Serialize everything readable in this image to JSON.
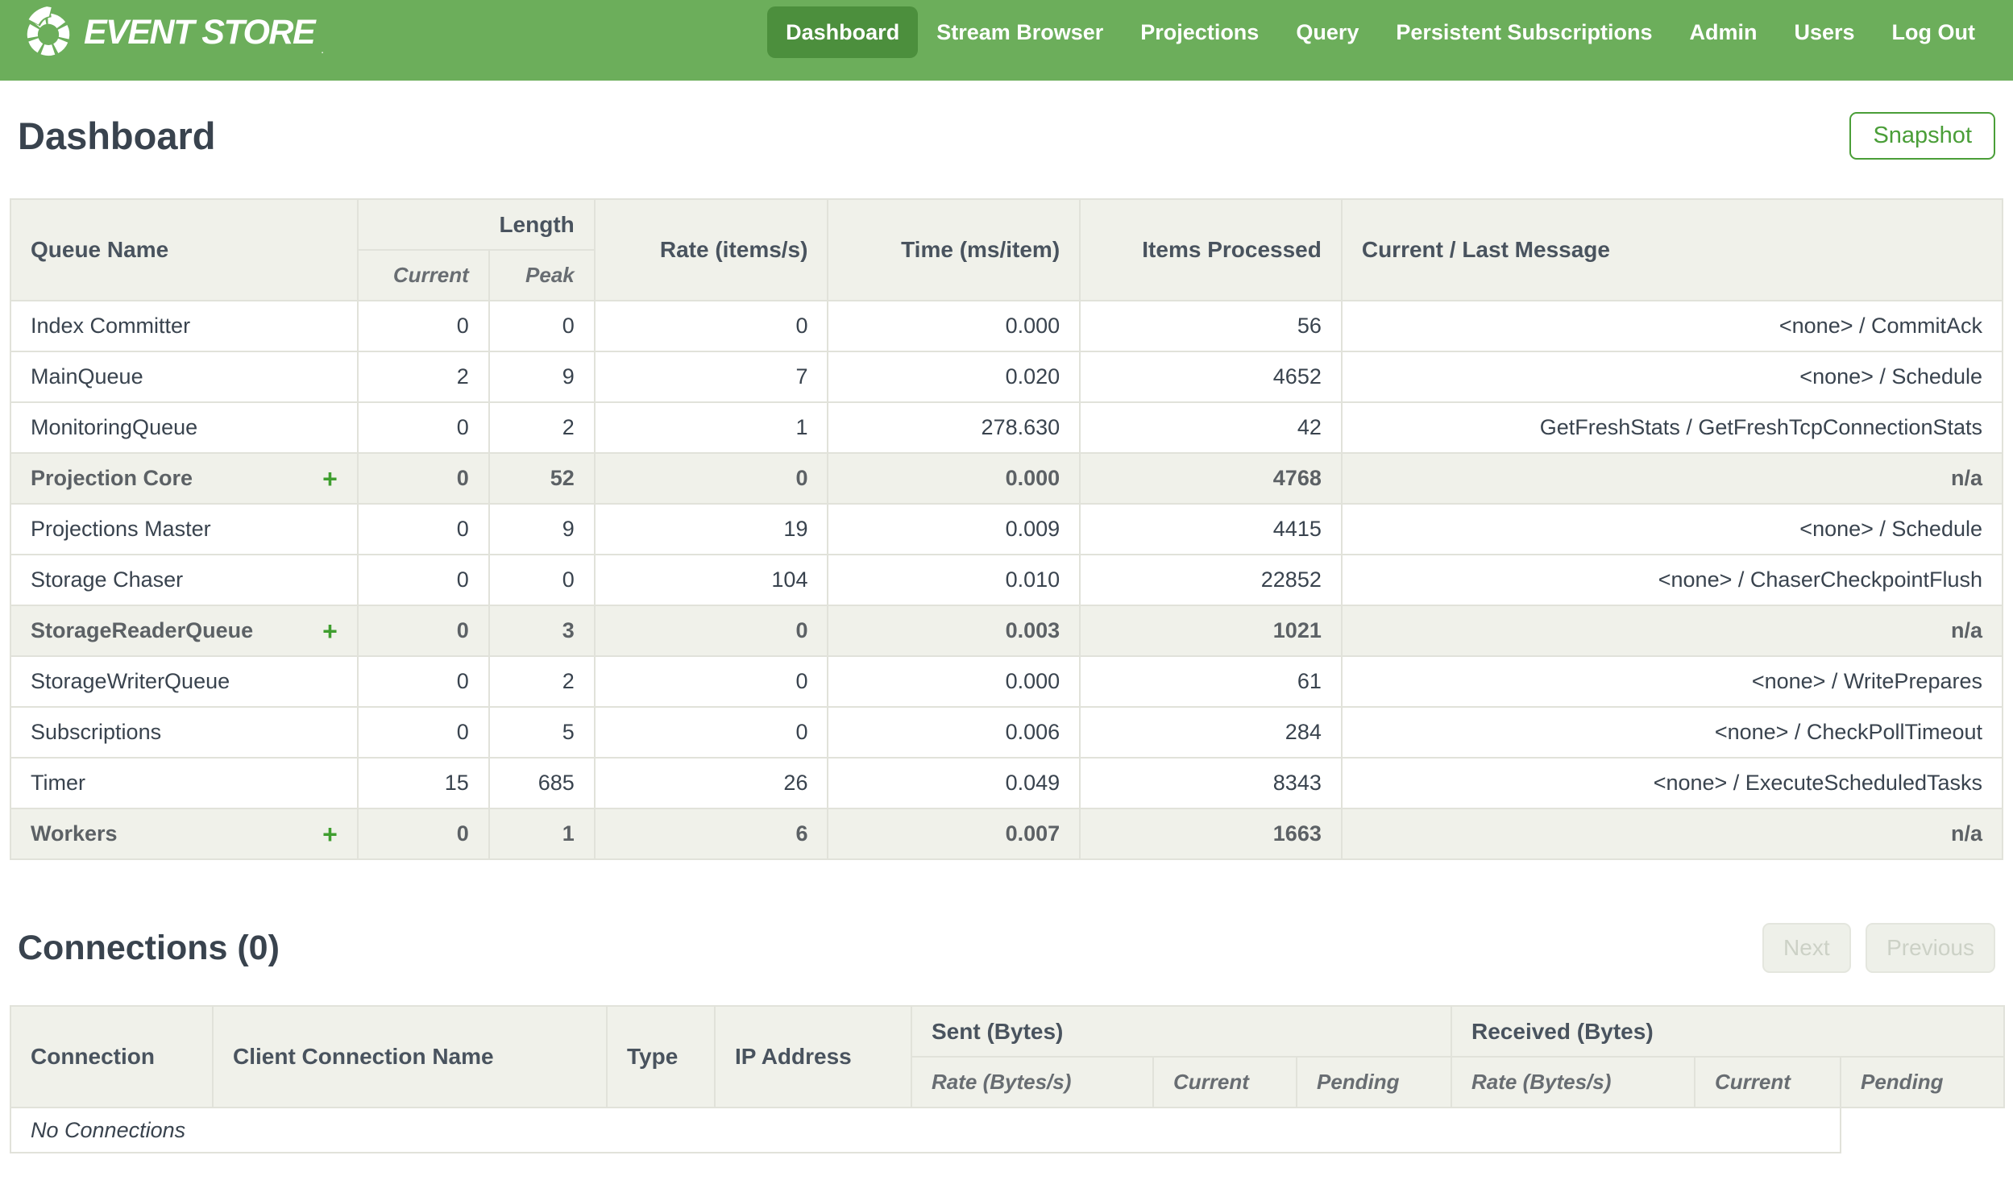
{
  "nav": {
    "brand": "EVENT STORE",
    "brand_mark": ".",
    "items": [
      {
        "label": "Dashboard",
        "active": true
      },
      {
        "label": "Stream Browser",
        "active": false
      },
      {
        "label": "Projections",
        "active": false
      },
      {
        "label": "Query",
        "active": false
      },
      {
        "label": "Persistent Subscriptions",
        "active": false
      },
      {
        "label": "Admin",
        "active": false
      },
      {
        "label": "Users",
        "active": false
      },
      {
        "label": "Log Out",
        "active": false
      }
    ]
  },
  "page": {
    "title": "Dashboard",
    "snapshot_label": "Snapshot"
  },
  "queues": {
    "headers": {
      "queue_name": "Queue Name",
      "length": "Length",
      "current": "Current",
      "peak": "Peak",
      "rate": "Rate (items/s)",
      "time": "Time (ms/item)",
      "items": "Items Processed",
      "message": "Current / Last Message"
    },
    "rows": [
      {
        "name": "Index Committer",
        "group": false,
        "current": "0",
        "peak": "0",
        "rate": "0",
        "time": "0.000",
        "items": "56",
        "message": "<none> / CommitAck"
      },
      {
        "name": "MainQueue",
        "group": false,
        "current": "2",
        "peak": "9",
        "rate": "7",
        "time": "0.020",
        "items": "4652",
        "message": "<none> / Schedule"
      },
      {
        "name": "MonitoringQueue",
        "group": false,
        "current": "0",
        "peak": "2",
        "rate": "1",
        "time": "278.630",
        "items": "42",
        "message": "GetFreshStats / GetFreshTcpConnectionStats"
      },
      {
        "name": "Projection Core",
        "group": true,
        "current": "0",
        "peak": "52",
        "rate": "0",
        "time": "0.000",
        "items": "4768",
        "message": "n/a"
      },
      {
        "name": "Projections Master",
        "group": false,
        "current": "0",
        "peak": "9",
        "rate": "19",
        "time": "0.009",
        "items": "4415",
        "message": "<none> / Schedule"
      },
      {
        "name": "Storage Chaser",
        "group": false,
        "current": "0",
        "peak": "0",
        "rate": "104",
        "time": "0.010",
        "items": "22852",
        "message": "<none> / ChaserCheckpointFlush"
      },
      {
        "name": "StorageReaderQueue",
        "group": true,
        "current": "0",
        "peak": "3",
        "rate": "0",
        "time": "0.003",
        "items": "1021",
        "message": "n/a"
      },
      {
        "name": "StorageWriterQueue",
        "group": false,
        "current": "0",
        "peak": "2",
        "rate": "0",
        "time": "0.000",
        "items": "61",
        "message": "<none> / WritePrepares"
      },
      {
        "name": "Subscriptions",
        "group": false,
        "current": "0",
        "peak": "5",
        "rate": "0",
        "time": "0.006",
        "items": "284",
        "message": "<none> / CheckPollTimeout"
      },
      {
        "name": "Timer",
        "group": false,
        "current": "15",
        "peak": "685",
        "rate": "26",
        "time": "0.049",
        "items": "8343",
        "message": "<none> / ExecuteScheduledTasks"
      },
      {
        "name": "Workers",
        "group": true,
        "current": "0",
        "peak": "1",
        "rate": "6",
        "time": "0.007",
        "items": "1663",
        "message": "n/a"
      }
    ],
    "expand_glyph": "+"
  },
  "connections": {
    "title": "Connections (0)",
    "pager": {
      "next": "Next",
      "previous": "Previous"
    },
    "headers": {
      "connection": "Connection",
      "client_name": "Client Connection Name",
      "type": "Type",
      "ip": "IP Address",
      "sent": "Sent (Bytes)",
      "received": "Received (Bytes)",
      "rate": "Rate (Bytes/s)",
      "current": "Current",
      "pending": "Pending"
    },
    "empty_message": "No Connections"
  },
  "colors": {
    "nav_green": "#6cae5b",
    "nav_active_green": "#4c8f3d",
    "accent_green": "#4a9e38",
    "table_header_bg": "#f0f1ea",
    "border": "#e1e2da",
    "text_dark": "#39434e",
    "disabled_text": "#ccd1c6"
  }
}
